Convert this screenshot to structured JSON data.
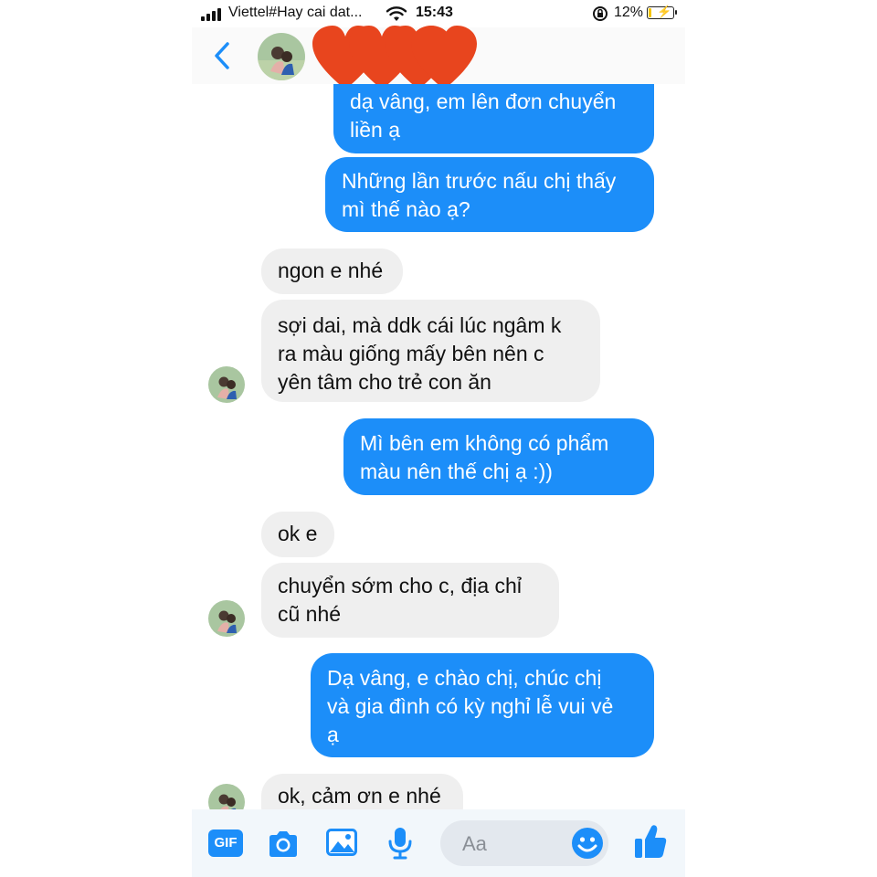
{
  "status_bar": {
    "carrier": "Viettel#Hay cai dat...",
    "time": "15:43",
    "battery_percent": "12%",
    "battery_level": 0.12
  },
  "header": {
    "back_icon": "chevron-left-icon",
    "avatar_icon": "contact-avatar",
    "sticker": "hearts-sticker"
  },
  "messages": [
    {
      "from": "me",
      "text": "dạ vâng, em lên đơn chuyển\nliền ạ"
    },
    {
      "from": "me",
      "text": "Những lần trước nấu chị thấy\nmì thế nào ạ?"
    },
    {
      "from": "them",
      "text": "ngon e nhé"
    },
    {
      "from": "them",
      "text": "sợi dai, mà ddk cái lúc ngâm k\nra màu giống mấy bên nên c\nyên tâm cho trẻ con ăn"
    },
    {
      "from": "me",
      "text": "Mì bên  em không có phẩm\nmàu nên thế chị ạ :))"
    },
    {
      "from": "them",
      "text": "ok e"
    },
    {
      "from": "them",
      "text": "chuyển sớm cho c, địa chỉ\ncũ nhé"
    },
    {
      "from": "me",
      "text": "Dạ vâng, e chào chị, chúc chị\nvà gia đình có kỳ nghỉ lễ vui vẻ\nạ"
    },
    {
      "from": "them",
      "text": "ok, cảm ơn e nhé"
    }
  ],
  "composer": {
    "gif_label": "GIF",
    "placeholder": "Aa",
    "icons": [
      "gif-icon",
      "camera-icon",
      "image-icon",
      "microphone-icon",
      "emoji-icon",
      "like-icon"
    ]
  },
  "colors": {
    "accent": "#1c8ef9",
    "incoming_bubble": "#efefef",
    "outgoing_text": "#ffffff",
    "hearts": "#e8451e"
  }
}
